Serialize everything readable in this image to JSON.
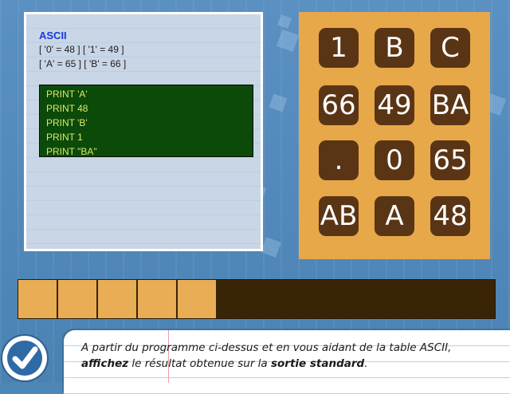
{
  "code_panel": {
    "title": "ASCII",
    "table_lines": [
      "[ '0' = 48 ] [ '1' = 49 ]",
      "[ 'A' = 65 ] [ 'B' = 66 ]"
    ],
    "program_lines": [
      "PRINT 'A'",
      "PRINT 48",
      "PRINT 'B'",
      "PRINT 1",
      "PRINT \"BA\""
    ]
  },
  "tiles": [
    "1",
    "B",
    "C",
    "66",
    "49",
    "BA",
    ".",
    "0",
    "65",
    "AB",
    "A",
    "48"
  ],
  "progress": {
    "filled": 5,
    "total": 12
  },
  "instruction": {
    "line1": "A partir du programme ci-dessus et en vous aidant de la table ASCII,",
    "line2_bold1": "affichez",
    "line2_mid": " le résultat obtenue sur la ",
    "line2_bold2": "sortie standard",
    "line2_end": "."
  },
  "icons": {
    "check": "checkmark-icon"
  },
  "colors": {
    "tile": "#5a3515",
    "board": "#e7a84a",
    "console": "#0c4a0a",
    "accent": "#2f6aa6"
  }
}
